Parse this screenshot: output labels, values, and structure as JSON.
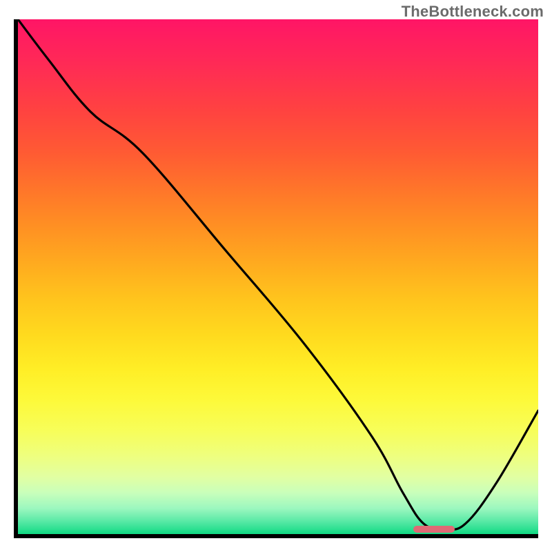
{
  "watermark": "TheBottleneck.com",
  "chart_data": {
    "type": "line",
    "title": "",
    "xlabel": "",
    "ylabel": "",
    "xlim": [
      0,
      100
    ],
    "ylim": [
      0,
      100
    ],
    "grid": false,
    "legend": false,
    "series": [
      {
        "name": "bottleneck-curve",
        "x": [
          0,
          6,
          14,
          24,
          40,
          55,
          68,
          74,
          78,
          82,
          86,
          92,
          100
        ],
        "y": [
          100,
          92,
          82,
          74,
          55,
          37,
          19,
          8,
          2,
          1,
          2,
          10,
          24
        ]
      }
    ],
    "annotations": [
      {
        "name": "optimal-marker",
        "x_start": 76,
        "x_end": 84,
        "y": 1,
        "color": "#e06a75"
      }
    ],
    "gradient_colors": [
      "#ff1566",
      "#ff2b55",
      "#ff4340",
      "#ff5b33",
      "#ff752a",
      "#ff8f23",
      "#ffa91f",
      "#ffc31d",
      "#ffd91e",
      "#ffee26",
      "#fdf93a",
      "#f7fe5a",
      "#eeff80",
      "#e1ffa3",
      "#c9ffbb",
      "#9cf7bf",
      "#59e9a6",
      "#11da84"
    ]
  }
}
